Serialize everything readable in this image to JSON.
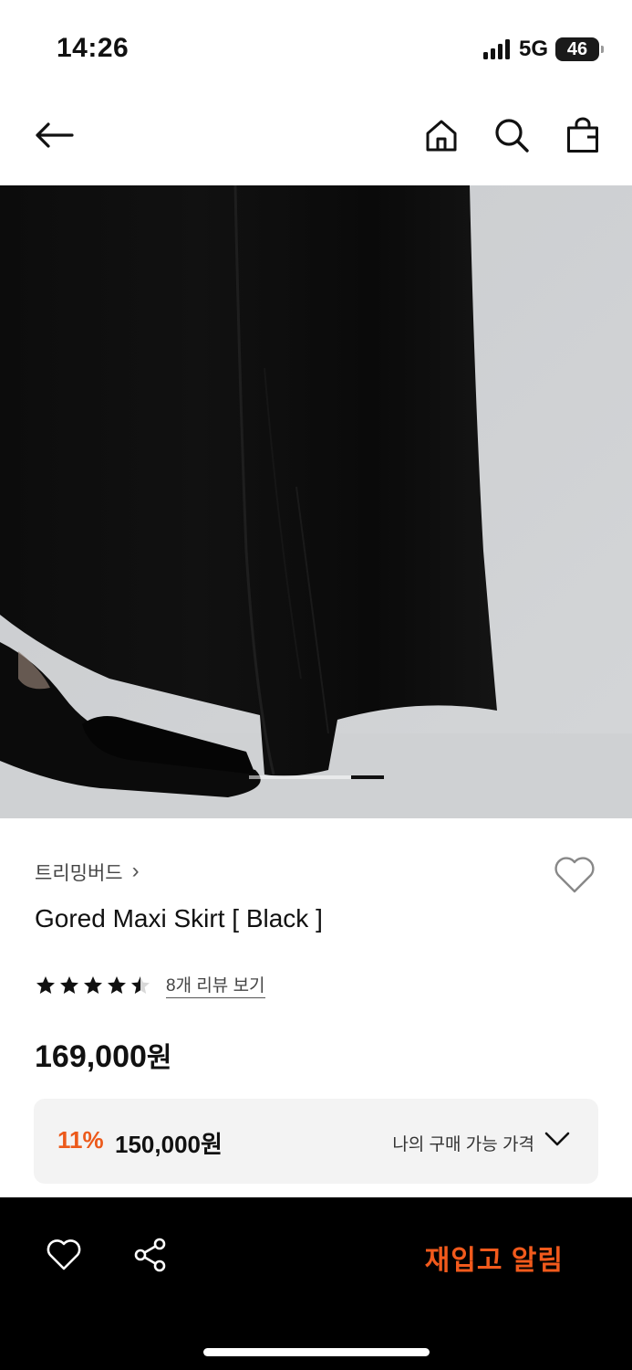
{
  "status_bar": {
    "time": "14:26",
    "network": "5G",
    "battery": "46"
  },
  "nav": {
    "icons": [
      "arrow-left-icon",
      "home-icon",
      "search-icon",
      "shopping-bag-icon"
    ]
  },
  "product_image": {
    "description_icon": "product-photo",
    "slide_indicator_active": 2,
    "slide_indicator_total": 2
  },
  "product": {
    "brand": "트리밍버드",
    "brand_chevron": "›",
    "name": "Gored Maxi Skirt [ Black ]",
    "rating": 4.5,
    "review_link": "8개 리뷰 보기",
    "price": "169,000",
    "price_unit": "원"
  },
  "member_price": {
    "discount": "11%",
    "price": "150,000원",
    "label": "나의 구매 가능 가격"
  },
  "bottom_bar": {
    "restock_label": "재입고 알림"
  },
  "colors": {
    "accent": "#ec5a1b",
    "restock": "#f25a1c",
    "bar_bg": "#000000",
    "box_bg": "#f3f3f3"
  }
}
